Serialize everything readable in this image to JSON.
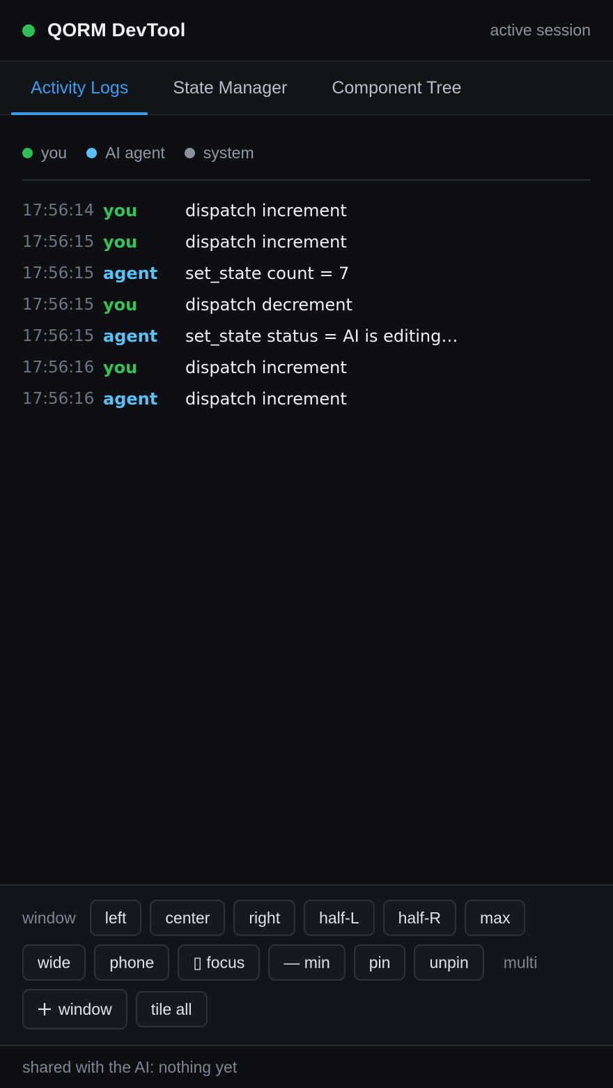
{
  "header": {
    "title": "QORM DevTool",
    "session": "active session",
    "status_color": "#2fbf55"
  },
  "tabs": [
    {
      "label": "Activity Logs",
      "active": true
    },
    {
      "label": "State Manager",
      "active": false
    },
    {
      "label": "Component Tree",
      "active": false
    }
  ],
  "legend": [
    {
      "label": "you",
      "color": "#2fbf55"
    },
    {
      "label": "AI agent",
      "color": "#5bc0f5"
    },
    {
      "label": "system",
      "color": "#8a919c"
    }
  ],
  "colors": {
    "you": "#34c25a",
    "agent": "#5bc0f5",
    "accent": "#3b9cf0"
  },
  "logs": [
    {
      "time": "17:56:14",
      "actor": "you",
      "action": "dispatch increment"
    },
    {
      "time": "17:56:15",
      "actor": "you",
      "action": "dispatch increment"
    },
    {
      "time": "17:56:15",
      "actor": "agent",
      "action": "set_state count = 7"
    },
    {
      "time": "17:56:15",
      "actor": "you",
      "action": "dispatch decrement"
    },
    {
      "time": "17:56:15",
      "actor": "agent",
      "action": "set_state status = AI is editing…"
    },
    {
      "time": "17:56:16",
      "actor": "you",
      "action": "dispatch increment"
    },
    {
      "time": "17:56:16",
      "actor": "agent",
      "action": "dispatch increment"
    }
  ],
  "controls": {
    "label": "window",
    "row1": [
      "left",
      "center",
      "right",
      "half-L",
      "half-R",
      "max"
    ],
    "row2": [
      "wide",
      "phone",
      "▯ focus",
      "— min",
      "pin",
      "unpin"
    ],
    "multi_label": "multi",
    "add_window": "window",
    "tile_all": "tile all"
  },
  "footer": {
    "text": "shared with the AI: nothing yet"
  }
}
